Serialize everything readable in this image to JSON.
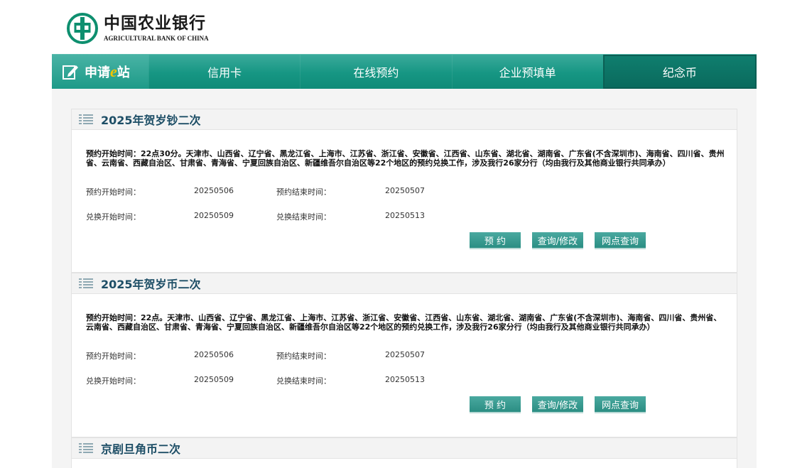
{
  "logo": {
    "cn": "中国农业银行",
    "en": "AGRICULTURAL BANK OF CHINA"
  },
  "nav": {
    "brand_prefix": "申请",
    "brand_e": "e",
    "brand_suffix": "站",
    "tabs": [
      {
        "label": "信用卡",
        "active": false
      },
      {
        "label": "在线预约",
        "active": false
      },
      {
        "label": "企业预填单",
        "active": false
      },
      {
        "label": "纪念币",
        "active": true
      }
    ]
  },
  "colors": {
    "accent": "#169683",
    "title": "#1d4e66",
    "button": "#3a9d93"
  },
  "sections": [
    {
      "title": "2025年贺岁钞二次",
      "desc": "预约开始时间：22点30分。天津市、山西省、辽宁省、黑龙江省、上海市、江苏省、浙江省、安徽省、江西省、山东省、湖北省、湖南省、广东省(不含深圳市)、海南省、四川省、贵州省、云南省、西藏自治区、甘肃省、青海省、宁夏回族自治区、新疆维吾尔自治区等22个地区的预约兑换工作，涉及我行26家分行（均由我行及其他商业银行共同承办）",
      "reserve_start_label": "预约开始时间：",
      "reserve_start": "20250506",
      "reserve_end_label": "预约结束时间：",
      "reserve_end": "20250507",
      "exchange_start_label": "兑换开始时间：",
      "exchange_start": "20250509",
      "exchange_end_label": "兑换结束时间：",
      "exchange_end": "20250513",
      "btn_reserve": "预 约",
      "btn_query": "查询/修改",
      "btn_branch": "网点查询"
    },
    {
      "title": "2025年贺岁币二次",
      "desc": "预约开始时间：22点。天津市、山西省、辽宁省、黑龙江省、上海市、江苏省、浙江省、安徽省、江西省、山东省、湖北省、湖南省、广东省(不含深圳市)、海南省、四川省、贵州省、云南省、西藏自治区、甘肃省、青海省、宁夏回族自治区、新疆维吾尔自治区等22个地区的预约兑换工作，涉及我行26家分行（均由我行及其他商业银行共同承办）",
      "reserve_start_label": "预约开始时间：",
      "reserve_start": "20250506",
      "reserve_end_label": "预约结束时间：",
      "reserve_end": "20250507",
      "exchange_start_label": "兑换开始时间：",
      "exchange_start": "20250509",
      "exchange_end_label": "兑换结束时间：",
      "exchange_end": "20250513",
      "btn_reserve": "预 约",
      "btn_query": "查询/修改",
      "btn_branch": "网点查询"
    },
    {
      "title": "京剧旦角币二次"
    }
  ]
}
